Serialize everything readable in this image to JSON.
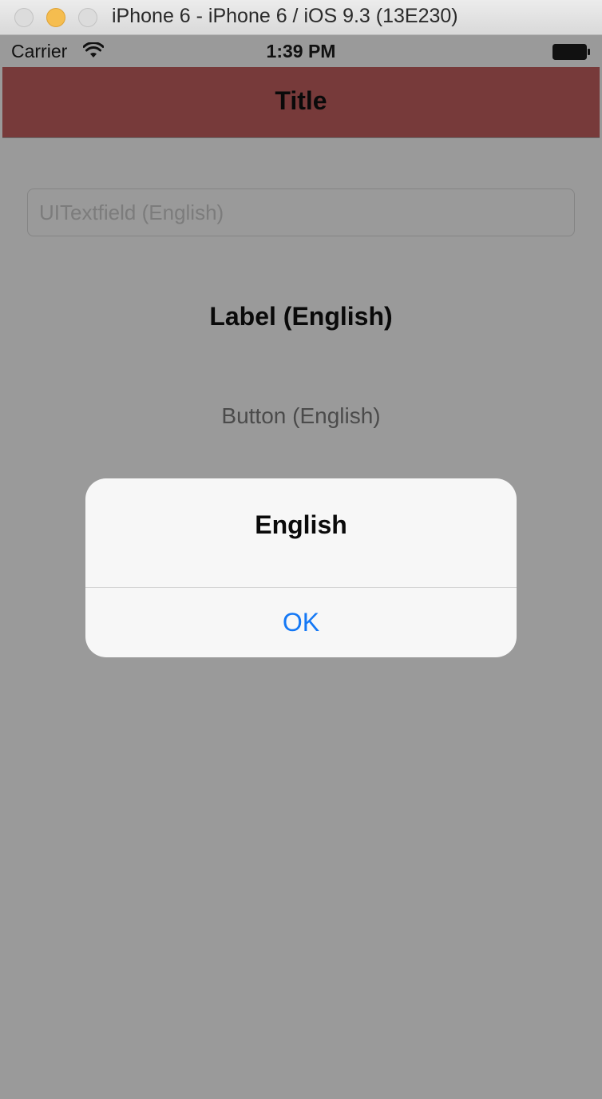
{
  "window": {
    "title": "iPhone 6 - iPhone 6 / iOS 9.3 (13E230)"
  },
  "status_bar": {
    "carrier": "Carrier",
    "time": "1:39 PM"
  },
  "nav_bar": {
    "title": "Title",
    "color": "#773a3a"
  },
  "content": {
    "textfield_placeholder": "UITextfield (English)",
    "label": "Label (English)",
    "button": "Button (English)"
  },
  "alert": {
    "title": "English",
    "ok_button": "OK",
    "ok_color": "#1478f5"
  },
  "icons": [
    "wifi-icon",
    "battery-icon"
  ]
}
